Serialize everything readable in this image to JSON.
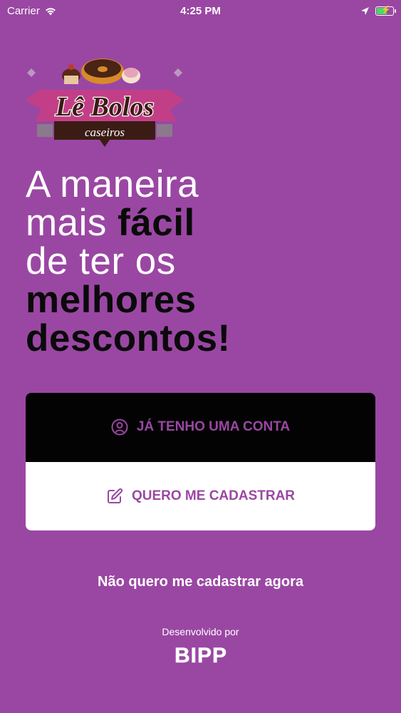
{
  "status_bar": {
    "carrier": "Carrier",
    "time": "4:25 PM"
  },
  "logo": {
    "title": "Lê Bolos",
    "subtitle": "caseiros"
  },
  "headline": {
    "line1": "A maneira",
    "line2_light": "mais ",
    "line2_bold": "fácil",
    "line3": "de ter os",
    "line4": "melhores",
    "line5": "descontos!"
  },
  "buttons": {
    "login_label": "JÁ TENHO UMA CONTA",
    "register_label": "QUERO ME CADASTRAR"
  },
  "skip_label": "Não quero me cadastrar agora",
  "footer": {
    "developed_by": "Desenvolvido por",
    "brand": "BIPP"
  },
  "colors": {
    "background": "#9a47a3",
    "accent": "#9a47a3",
    "dark": "#030303",
    "battery": "#4cd964"
  }
}
